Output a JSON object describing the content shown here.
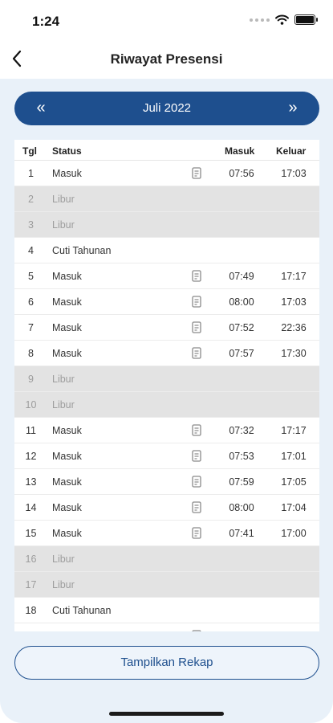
{
  "status_bar": {
    "time": "1:24"
  },
  "header": {
    "title": "Riwayat Presensi"
  },
  "month_nav": {
    "prev": "«",
    "label": "Juli 2022",
    "next": "»"
  },
  "table": {
    "headers": {
      "tgl": "Tgl",
      "status": "Status",
      "masuk": "Masuk",
      "keluar": "Keluar"
    },
    "rows": [
      {
        "tgl": "1",
        "status": "Masuk",
        "masuk": "07:56",
        "keluar": "17:03",
        "off": false,
        "icon": true
      },
      {
        "tgl": "2",
        "status": "Libur",
        "masuk": "",
        "keluar": "",
        "off": true,
        "icon": false
      },
      {
        "tgl": "3",
        "status": "Libur",
        "masuk": "",
        "keluar": "",
        "off": true,
        "icon": false
      },
      {
        "tgl": "4",
        "status": "Cuti Tahunan",
        "masuk": "",
        "keluar": "",
        "off": false,
        "icon": false
      },
      {
        "tgl": "5",
        "status": "Masuk",
        "masuk": "07:49",
        "keluar": "17:17",
        "off": false,
        "icon": true
      },
      {
        "tgl": "6",
        "status": "Masuk",
        "masuk": "08:00",
        "keluar": "17:03",
        "off": false,
        "icon": true
      },
      {
        "tgl": "7",
        "status": "Masuk",
        "masuk": "07:52",
        "keluar": "22:36",
        "off": false,
        "icon": true
      },
      {
        "tgl": "8",
        "status": "Masuk",
        "masuk": "07:57",
        "keluar": "17:30",
        "off": false,
        "icon": true
      },
      {
        "tgl": "9",
        "status": "Libur",
        "masuk": "",
        "keluar": "",
        "off": true,
        "icon": false
      },
      {
        "tgl": "10",
        "status": "Libur",
        "masuk": "",
        "keluar": "",
        "off": true,
        "icon": false
      },
      {
        "tgl": "11",
        "status": "Masuk",
        "masuk": "07:32",
        "keluar": "17:17",
        "off": false,
        "icon": true
      },
      {
        "tgl": "12",
        "status": "Masuk",
        "masuk": "07:53",
        "keluar": "17:01",
        "off": false,
        "icon": true
      },
      {
        "tgl": "13",
        "status": "Masuk",
        "masuk": "07:59",
        "keluar": "17:05",
        "off": false,
        "icon": true
      },
      {
        "tgl": "14",
        "status": "Masuk",
        "masuk": "08:00",
        "keluar": "17:04",
        "off": false,
        "icon": true
      },
      {
        "tgl": "15",
        "status": "Masuk",
        "masuk": "07:41",
        "keluar": "17:00",
        "off": false,
        "icon": true
      },
      {
        "tgl": "16",
        "status": "Libur",
        "masuk": "",
        "keluar": "",
        "off": true,
        "icon": false
      },
      {
        "tgl": "17",
        "status": "Libur",
        "masuk": "",
        "keluar": "",
        "off": true,
        "icon": false
      },
      {
        "tgl": "18",
        "status": "Cuti Tahunan",
        "masuk": "",
        "keluar": "",
        "off": false,
        "icon": false
      },
      {
        "tgl": "",
        "status": "",
        "masuk": "",
        "keluar": "",
        "off": false,
        "icon": true
      }
    ]
  },
  "recap_button": {
    "label": "Tampilkan Rekap"
  },
  "icons": {
    "back": "chevron-left-icon",
    "row": "document-icon",
    "wifi": "wifi-icon",
    "battery": "battery-icon"
  },
  "colors": {
    "primary": "#1e4f8e",
    "background": "#e9f1f9",
    "holiday_row": "#e3e3e3"
  }
}
